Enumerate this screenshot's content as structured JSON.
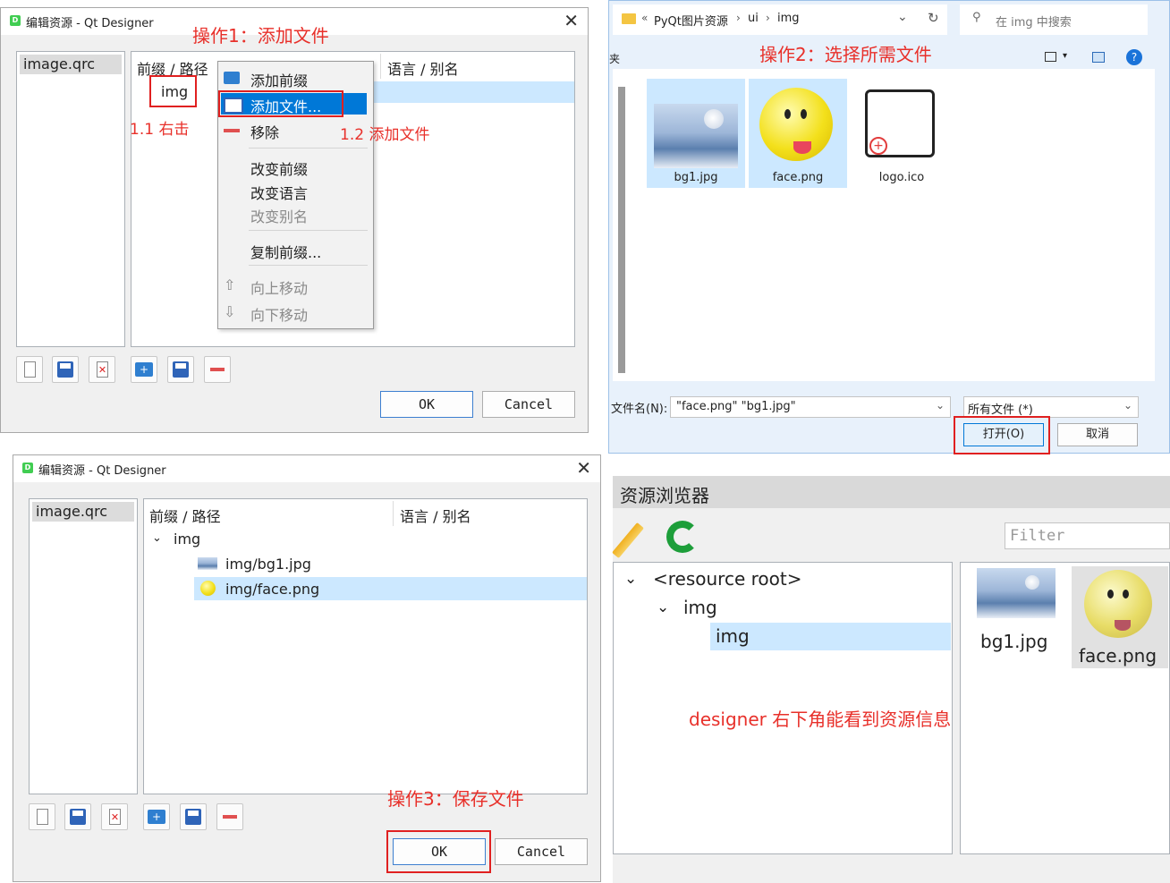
{
  "annotations": {
    "op1": "操作1：添加文件",
    "op2": "操作2：选择所需文件",
    "op3": "操作3：保存文件",
    "right_click": "1.1 右击",
    "add_file_step": "1.2 添加文件",
    "designer_note": "designer 右下角能看到资源信息"
  },
  "dialog1": {
    "title": "编辑资源 - Qt Designer",
    "close_glyph": "✕",
    "qrc_file": "image.qrc",
    "col_prefix_path": "前缀 / 路径",
    "col_lang_alias": "语言 / 别名",
    "prefix": "img",
    "ok_label": "OK",
    "cancel_label": "Cancel"
  },
  "context_menu": {
    "items": [
      {
        "label": "添加前缀",
        "enabled": true
      },
      {
        "label": "添加文件...",
        "enabled": true,
        "selected": true
      },
      {
        "label": "移除",
        "enabled": true
      },
      {
        "label": "改变前缀",
        "enabled": true
      },
      {
        "label": "改变语言",
        "enabled": true
      },
      {
        "label": "改变别名",
        "enabled": false
      },
      {
        "label": "复制前缀...",
        "enabled": true
      },
      {
        "label": "向上移动",
        "enabled": false
      },
      {
        "label": "向下移动",
        "enabled": false
      }
    ]
  },
  "file_dialog": {
    "breadcrumb": [
      "«",
      "PyQt图片资源",
      "ui",
      "img"
    ],
    "search_placeholder": "在 img 中搜索",
    "sidebar_stub": "夹",
    "files": [
      {
        "name": "bg1.jpg",
        "selected": true
      },
      {
        "name": "face.png",
        "selected": true
      },
      {
        "name": "logo.ico",
        "selected": false
      }
    ],
    "filename_label": "文件名(N):",
    "filename_value": "\"face.png\" \"bg1.jpg\"",
    "filter_value": "所有文件 (*)",
    "open_label": "打开(O)",
    "cancel_label": "取消"
  },
  "dialog2": {
    "title": "编辑资源 - Qt Designer",
    "close_glyph": "✕",
    "qrc_file": "image.qrc",
    "col_prefix_path": "前缀 / 路径",
    "col_lang_alias": "语言 / 别名",
    "prefix": "img",
    "files": [
      "img/bg1.jpg",
      "img/face.png"
    ],
    "ok_label": "OK",
    "cancel_label": "Cancel"
  },
  "resource_browser": {
    "title": "资源浏览器",
    "filter_placeholder": "Filter",
    "tree": [
      "<resource root>",
      "img",
      "img"
    ],
    "thumbnails": [
      "bg1.jpg",
      "face.png"
    ]
  },
  "colors": {
    "annotation_red": "#e8302a",
    "selection_blue": "#cce8ff",
    "menu_highlight": "#0078d7"
  }
}
